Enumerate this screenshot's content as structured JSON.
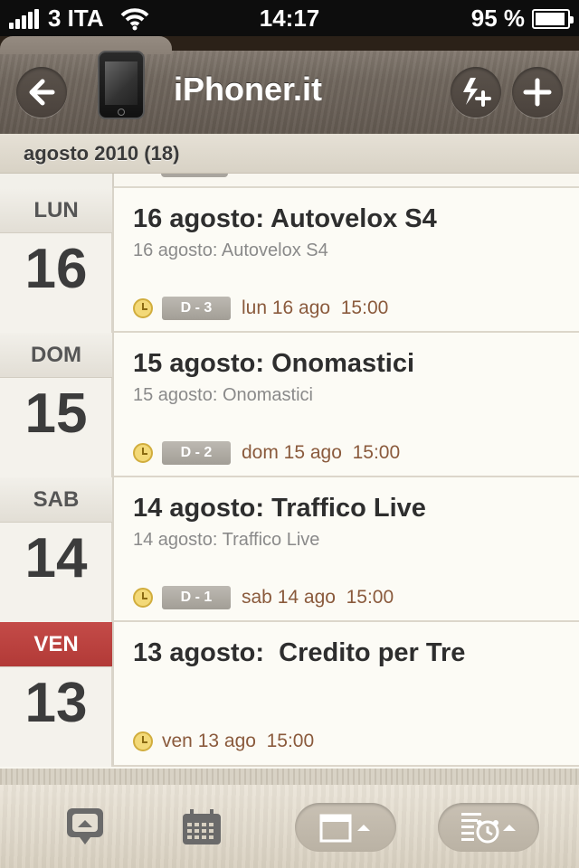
{
  "status_bar": {
    "carrier": "3 ITA",
    "time": "14:17",
    "battery": "95 %",
    "battery_level": 0.95
  },
  "header": {
    "title": "iPhoner.it",
    "icons": [
      "back-arrow-icon",
      "iphone-icon",
      "flash-add-icon",
      "plus-icon"
    ]
  },
  "section": {
    "title": "agosto 2010 (18)"
  },
  "items": [
    {
      "weekday": "LUN",
      "day": "16",
      "title": "16 agosto: Autovelox S4",
      "subtitle": "16 agosto: Autovelox S4",
      "badge": "D - 3",
      "meta": "lun 16 ago  15:00",
      "today": false
    },
    {
      "weekday": "DOM",
      "day": "15",
      "title": "15 agosto: Onomastici",
      "subtitle": "15 agosto: Onomastici",
      "badge": "D - 2",
      "meta": "dom 15 ago  15:00",
      "today": false
    },
    {
      "weekday": "SAB",
      "day": "14",
      "title": "14 agosto: Traffico Live",
      "subtitle": "14 agosto: Traffico Live",
      "badge": "D - 1",
      "meta": "sab 14 ago  15:00",
      "today": false
    },
    {
      "weekday": "VEN",
      "day": "13",
      "title": "13 agosto:  Credito per Tre",
      "subtitle": "",
      "badge": "",
      "meta": "ven 13 ago  15:00",
      "today": true
    }
  ],
  "colors": {
    "today_red": "#b23a37",
    "meta_brown": "#8a5a3c"
  },
  "tabbar": {
    "icons": [
      "message-icon",
      "calendar-grid-icon",
      "calendar-icon",
      "list-alarm-icon"
    ]
  }
}
